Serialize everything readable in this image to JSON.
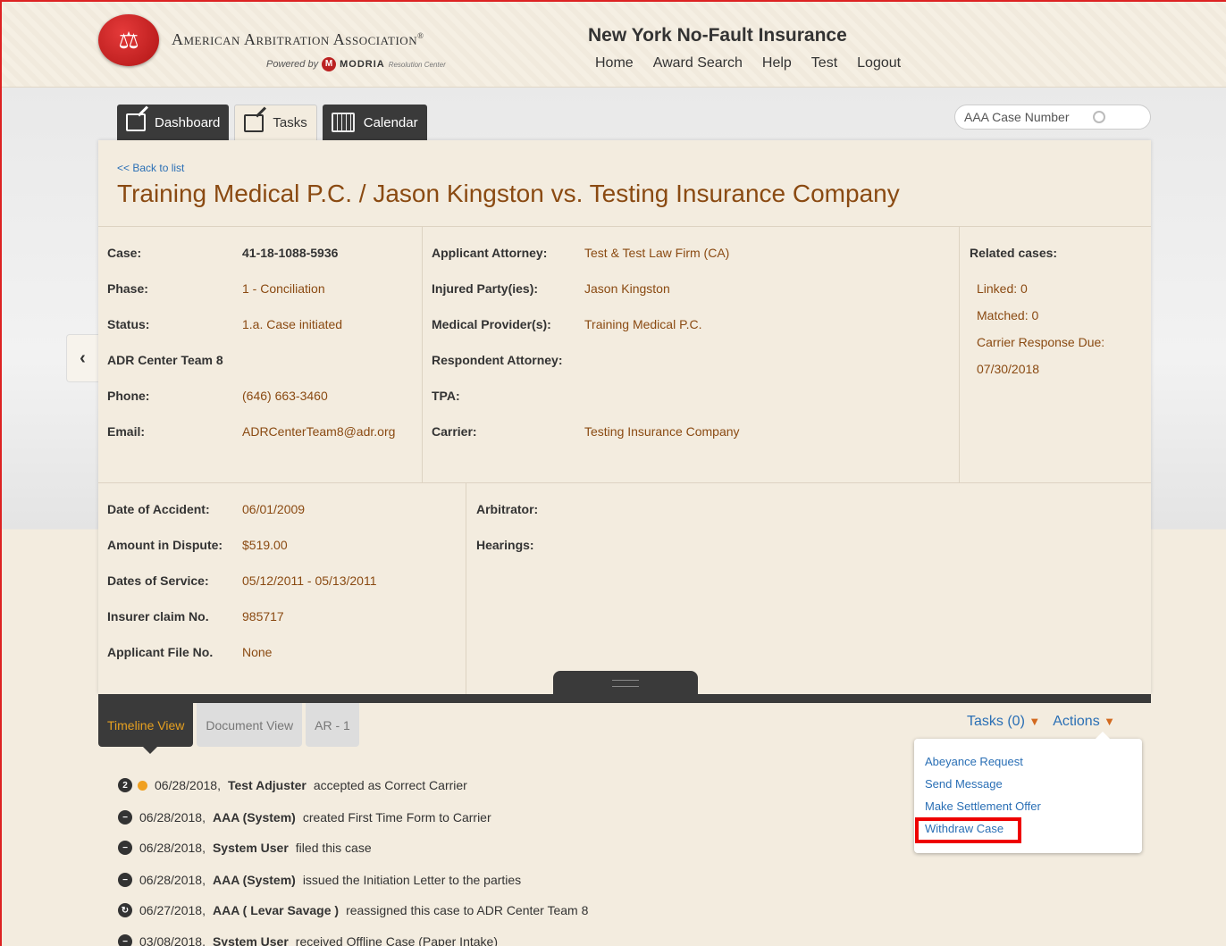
{
  "header": {
    "org_name": "American Arbitration Association",
    "reg_mark": "®",
    "powered_by": "Powered by",
    "powered_brand": "MODRIA",
    "powered_sub": "Resolution Center",
    "site_title": "New York No-Fault Insurance",
    "nav": [
      "Home",
      "Award Search",
      "Help",
      "Test",
      "Logout"
    ]
  },
  "tabs": [
    {
      "label": "Dashboard",
      "icon": "edit-icon"
    },
    {
      "label": "Tasks",
      "icon": "edit-icon"
    },
    {
      "label": "Calendar",
      "icon": "calendar-icon"
    }
  ],
  "search": {
    "placeholder": "AAA Case Number"
  },
  "case": {
    "back_link": "<< Back to list",
    "title": "Training Medical P.C. / Jason Kingston vs. Testing Insurance Company",
    "left": [
      {
        "label": "Case:",
        "value": "41-18-1088-5936"
      },
      {
        "label": "Phase:",
        "value": "1 - Conciliation"
      },
      {
        "label": "Status:",
        "value": "1.a. Case initiated"
      },
      {
        "label": "ADR Center Team 8",
        "value": ""
      },
      {
        "label": "Phone:",
        "value": "(646) 663-3460"
      },
      {
        "label": "Email:",
        "value": "ADRCenterTeam8@adr.org"
      }
    ],
    "middle": [
      {
        "label": "Applicant Attorney:",
        "value": "Test & Test Law Firm (CA)"
      },
      {
        "label": "Injured Party(ies):",
        "value": "Jason Kingston"
      },
      {
        "label": "Medical Provider(s):",
        "value": "Training Medical P.C."
      },
      {
        "label": "Respondent Attorney:",
        "value": ""
      },
      {
        "label": "TPA:",
        "value": ""
      },
      {
        "label": "Carrier:",
        "value": "Testing Insurance Company"
      }
    ],
    "related": {
      "heading": "Related cases:",
      "linked": "Linked: 0",
      "matched": "Matched: 0",
      "carrier_due_label": "Carrier Response Due:",
      "carrier_due": "07/30/2018"
    },
    "details": [
      {
        "label": "Date of Accident:",
        "value": "06/01/2009"
      },
      {
        "label": "Amount in Dispute:",
        "value": "$519.00"
      },
      {
        "label": "Dates of Service:",
        "value": "05/12/2011 - 05/13/2011"
      },
      {
        "label": "Insurer claim No.",
        "value": "985717"
      },
      {
        "label": "Applicant File No.",
        "value": "None"
      }
    ],
    "arbitrator_label": "Arbitrator:",
    "hearings_label": "Hearings:"
  },
  "lower_tabs": [
    "Timeline View",
    "Document View",
    "AR - 1"
  ],
  "actions": {
    "tasks": "Tasks (0)",
    "actions": "Actions",
    "menu": [
      "Abeyance Request",
      "Send Message",
      "Make Settlement Offer",
      "Withdraw Case"
    ]
  },
  "timeline": [
    {
      "badge": "2",
      "date": "06/28/2018,",
      "actor": "Test Adjuster",
      "text": "accepted as Correct Carrier"
    },
    {
      "badge": "",
      "date": "06/28/2018,",
      "actor": "AAA (System)",
      "text": "created First Time Form to Carrier"
    },
    {
      "badge": "",
      "date": "06/28/2018,",
      "actor": "System User",
      "text": "filed this case"
    },
    {
      "badge": "",
      "date": "06/28/2018,",
      "actor": "AAA (System)",
      "text": "issued the Initiation Letter to the parties"
    },
    {
      "badge": "",
      "date": "06/27/2018,",
      "actor": "AAA ( Levar Savage )",
      "text": "reassigned this case to ADR Center Team 8"
    },
    {
      "badge": "",
      "date": "03/08/2018,",
      "actor": "System User",
      "text": "received Offline Case (Paper Intake)"
    }
  ]
}
